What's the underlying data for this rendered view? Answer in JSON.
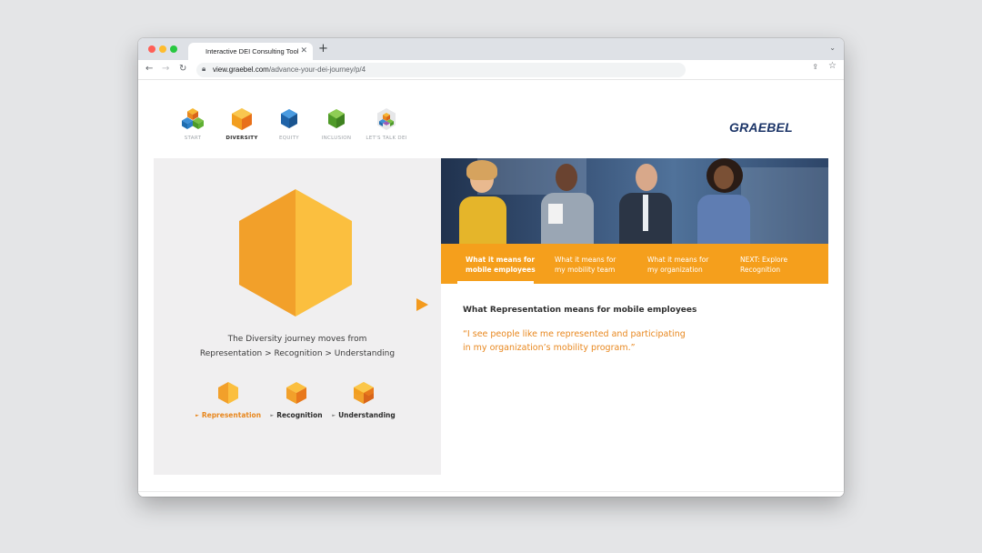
{
  "browser": {
    "tab_title": "Interactive DEI Consulting Tool",
    "tab_close": "✕",
    "new_tab": "+",
    "tab_menu": "⌄",
    "url_host": "view.graebel.com",
    "url_path": "/advance-your-dei-journey/p/4",
    "icons": [
      "back-icon",
      "forward-icon",
      "reload-icon",
      "lock-icon",
      "share-icon",
      "star-icon"
    ]
  },
  "site": {
    "logo": "GRAEBEL",
    "nav": [
      {
        "label": "START",
        "active": false
      },
      {
        "label": "DIVERSITY",
        "active": true
      },
      {
        "label": "EQUITY",
        "active": false
      },
      {
        "label": "INCLUSION",
        "active": false
      },
      {
        "label": "LET'S TALK DEI",
        "active": false
      }
    ]
  },
  "journey": {
    "line1": "The Diversity journey moves from",
    "line2": "Representation > Recognition > Understanding",
    "steps": [
      {
        "label": "Representation",
        "active": true
      },
      {
        "label": "Recognition",
        "active": false
      },
      {
        "label": "Understanding",
        "active": false
      }
    ],
    "marker": "►"
  },
  "tabs": [
    {
      "line1": "What it means for",
      "line2": "mobile employees",
      "active": true
    },
    {
      "line1": "What it means for",
      "line2": "my mobility team",
      "active": false
    },
    {
      "line1": "What it means for",
      "line2": "my organization",
      "active": false
    },
    {
      "line1": "NEXT: Explore",
      "line2": "Recognition",
      "active": false
    }
  ],
  "content": {
    "title": "What Representation means for mobile employees",
    "quote_line1": "“I see people like me represented and participating",
    "quote_line2": "in my organization’s mobility program.”"
  },
  "colors": {
    "accent_orange": "#f59f1c",
    "quote_orange": "#e8871e",
    "logo_navy": "#1c3568",
    "panel_gray": "#f0eff0"
  }
}
